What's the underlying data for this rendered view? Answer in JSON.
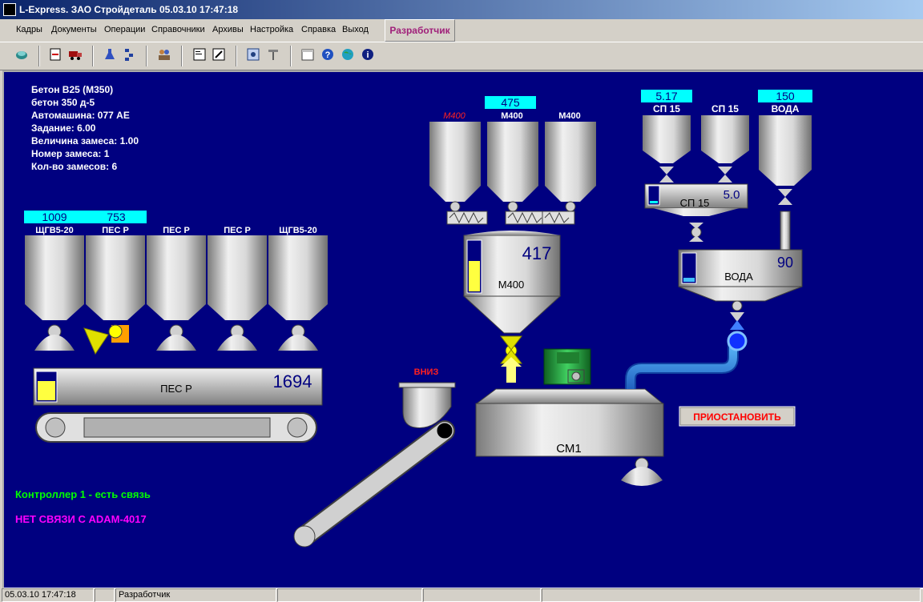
{
  "window": {
    "title": "L-Express. ЗАО Стройдеталь    05.03.10 17:47:18"
  },
  "menu": {
    "items": [
      "Кадры",
      "Документы",
      "Операции",
      "Справочники",
      "Архивы",
      "Настройка",
      "Справка",
      "Выход"
    ],
    "developer_tab": "Разработчик"
  },
  "toolbar": {
    "icons": [
      "connect-icon",
      "print-icon",
      "truck-icon",
      "flask-icon",
      "tree-icon",
      "users-icon",
      "report-icon",
      "edit-report-icon",
      "settings-icon",
      "tools-icon",
      "calendar-icon",
      "help-icon",
      "globe-icon",
      "info-icon"
    ]
  },
  "info": {
    "line1": "Бетон В25 (М350)",
    "line2": "бетон 350 д-5",
    "line3": "Автомашина: 077 AE",
    "line4": "Задание:    6.00",
    "line5": "Величина замеса:  1.00",
    "line6": "Номер замеса: 1",
    "line7": "Кол-во замесов: 6"
  },
  "aggregates": {
    "bins": [
      {
        "name": "ЩГВ5-20",
        "value": "1009"
      },
      {
        "name": "ПЕС Р",
        "value": "753"
      },
      {
        "name": "ПЕС Р",
        "value": ""
      },
      {
        "name": "ПЕС Р",
        "value": ""
      },
      {
        "name": "ЩГВ5-20",
        "value": ""
      }
    ],
    "scale_label": "ПЕС Р",
    "scale_value": "1694"
  },
  "cement": {
    "silo_labels": [
      "М400",
      "М400",
      "М400"
    ],
    "silo_value": "475",
    "scale_value": "417",
    "scale_label": "М400"
  },
  "additives": {
    "tanks": [
      {
        "name": "СП 15",
        "value": "5.17"
      },
      {
        "name": "СП 15",
        "value": ""
      },
      {
        "name": "ВОДА",
        "value": "150"
      }
    ],
    "sp_scale_label": "СП 15",
    "sp_scale_value": "5.0",
    "water_scale_label": "ВОДА",
    "water_scale_value": "90"
  },
  "mixer": {
    "label": "СМ1",
    "skip_label": "ВНИЗ",
    "stop_button": "ПРИОСТАНОВИТЬ"
  },
  "status": {
    "controller": "Контроллер 1 - есть связь",
    "adam": "НЕТ СВЯЗИ С ADAM-4017"
  },
  "statusbar": {
    "datetime": "05.03.10 17:47:18",
    "user": "Разработчик"
  },
  "colors": {
    "panel_bg": "#000080",
    "value_box": "#00ffff",
    "ok_green": "#00ff00",
    "error_magenta": "#ff00ff",
    "accent_yellow": "#ffff00"
  }
}
